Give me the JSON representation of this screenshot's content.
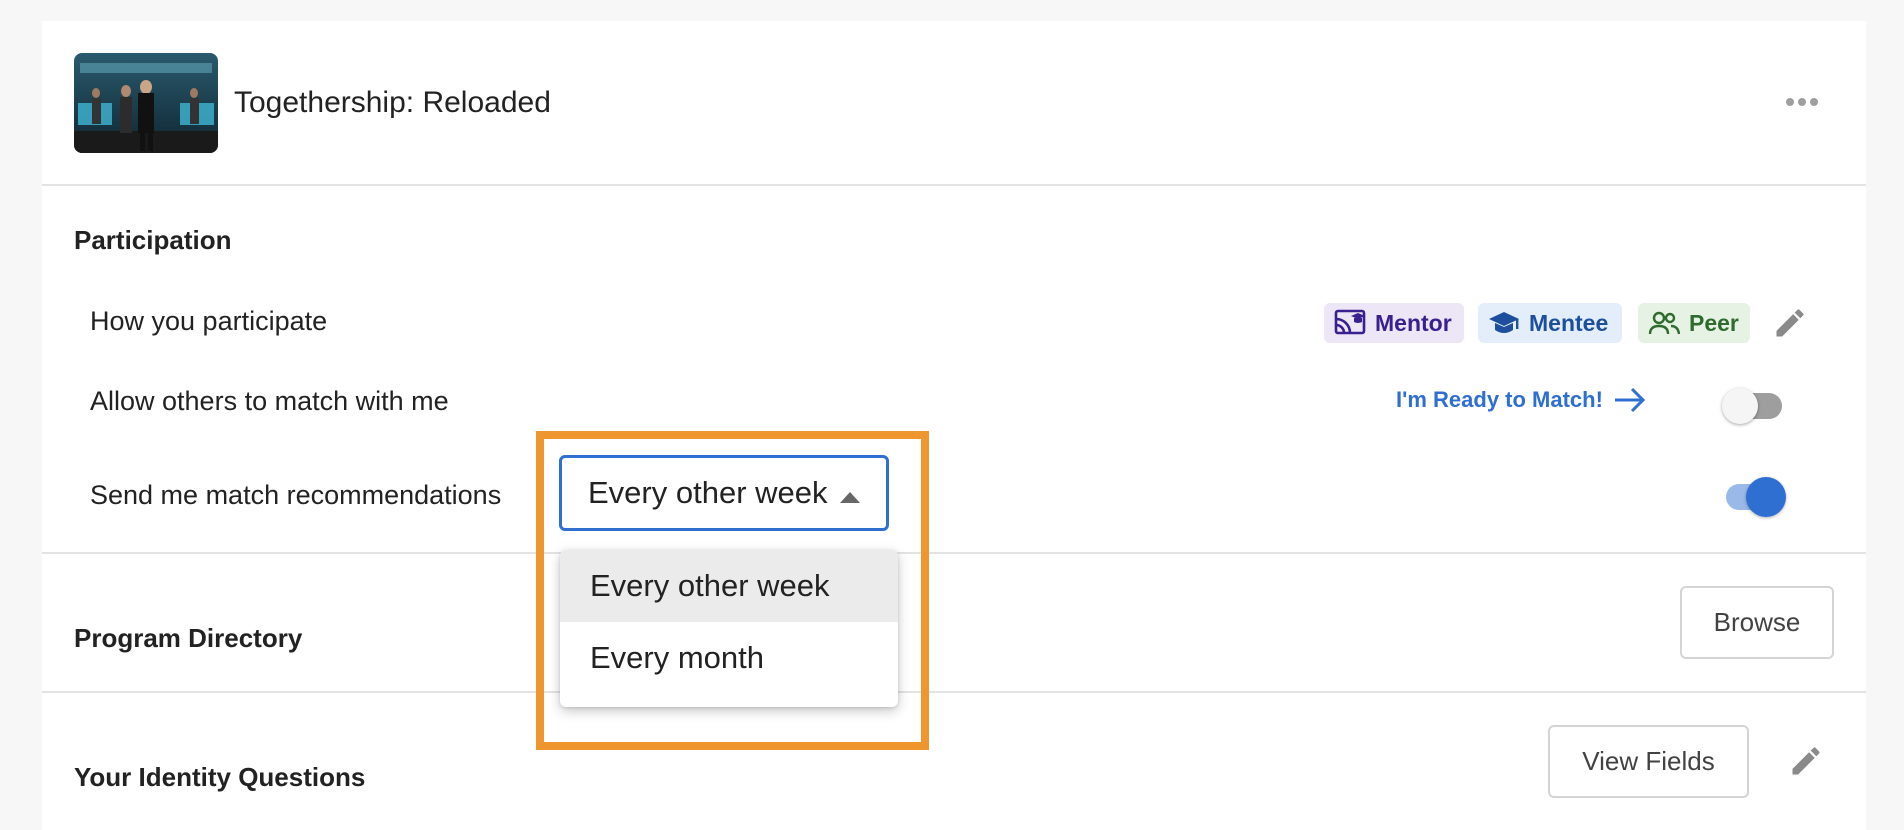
{
  "header": {
    "title": "Togethership: Reloaded"
  },
  "participation": {
    "section_title": "Participation",
    "how_label": "How you participate",
    "roles": [
      {
        "label": "Mentor",
        "icon": "mentor-icon",
        "text_color": "#3a1f8f",
        "bg_color": "#ece6f6"
      },
      {
        "label": "Mentee",
        "icon": "graduation-cap-icon",
        "text_color": "#1d4f9e",
        "bg_color": "#e3eefa"
      },
      {
        "label": "Peer",
        "icon": "people-icon",
        "text_color": "#2f6b2f",
        "bg_color": "#e6f2e4"
      }
    ],
    "allow_label": "Allow others to match with me",
    "ready_link": "I'm Ready to Match!",
    "allow_toggle_on": false,
    "recommend_label": "Send me match recommendations",
    "recommend_toggle_on": true,
    "frequency": {
      "selected": "Every other week",
      "options": [
        "Every other week",
        "Every month"
      ]
    }
  },
  "directory": {
    "title": "Program Directory",
    "button": "Browse"
  },
  "identity": {
    "title": "Your Identity Questions",
    "button": "View Fields"
  },
  "colors": {
    "accent": "#2e6fd1",
    "highlight": "#f0962e"
  }
}
